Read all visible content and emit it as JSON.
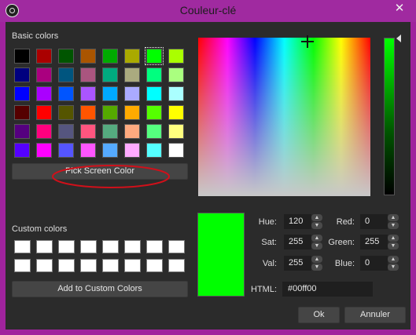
{
  "window": {
    "title": "Couleur-clé",
    "close_glyph": "✕",
    "icon": "obs-app-icon"
  },
  "basic_colors": {
    "label": "Basic colors",
    "rows": [
      [
        "#000000",
        "#aa0000",
        "#005500",
        "#aa5500",
        "#00aa00",
        "#aaaa00",
        "#00ff00",
        "#aaff00"
      ],
      [
        "#00007f",
        "#aa007f",
        "#00557f",
        "#aa557f",
        "#00aa7f",
        "#aaaa7f",
        "#00ff7f",
        "#aaff7f"
      ],
      [
        "#0000ff",
        "#aa00ff",
        "#0055ff",
        "#aa55ff",
        "#00aaff",
        "#aaaaff",
        "#00ffff",
        "#aaffff"
      ],
      [
        "#550000",
        "#ff0000",
        "#555500",
        "#ff5500",
        "#55aa00",
        "#ffaa00",
        "#55ff00",
        "#ffff00"
      ],
      [
        "#55007f",
        "#ff007f",
        "#55557f",
        "#ff557f",
        "#55aa7f",
        "#ffaa7f",
        "#55ff7f",
        "#ffff7f"
      ],
      [
        "#5500ff",
        "#ff00ff",
        "#5555ff",
        "#ff55ff",
        "#55aaff",
        "#ffaaff",
        "#55ffff",
        "#ffffff"
      ]
    ],
    "selected_row": 0,
    "selected_col": 6
  },
  "pick_screen_button": "Pick Screen Color",
  "custom_colors": {
    "label": "Custom colors",
    "count": 16
  },
  "add_custom_button": "Add to Custom Colors",
  "fields": {
    "hue": {
      "label": "Hue:",
      "value": "120"
    },
    "sat": {
      "label": "Sat:",
      "value": "255"
    },
    "val": {
      "label": "Val:",
      "value": "255"
    },
    "red": {
      "label": "Red:",
      "value": "0"
    },
    "green": {
      "label": "Green:",
      "value": "255"
    },
    "blue": {
      "label": "Blue:",
      "value": "0"
    },
    "html": {
      "label": "HTML:",
      "value": "#00ff00"
    }
  },
  "current_color": "#00ff00",
  "buttons": {
    "ok": "Ok",
    "cancel": "Annuler"
  },
  "annotation_color": "#d0101a"
}
